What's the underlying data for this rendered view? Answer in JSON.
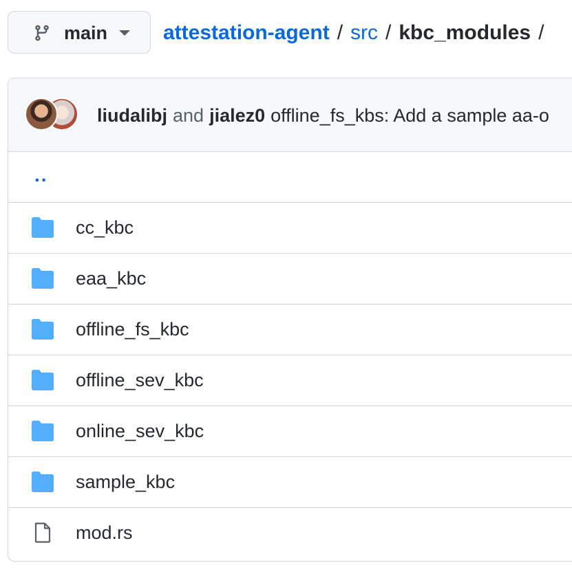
{
  "branch": {
    "name": "main",
    "icon": "git-branch-icon",
    "caret_icon": "triangle-down-icon"
  },
  "breadcrumb": {
    "root": "attestation-agent",
    "parts": [
      "src"
    ],
    "current": "kbc_modules",
    "separator": "/"
  },
  "commit": {
    "author1": "liudalibj",
    "conjunction": "and",
    "author2": "jialez0",
    "message": "offline_fs_kbs: Add a sample aa-o"
  },
  "files": {
    "parent": "..",
    "entries": [
      {
        "name": "cc_kbc",
        "type": "dir",
        "icon": "folder-icon"
      },
      {
        "name": "eaa_kbc",
        "type": "dir",
        "icon": "folder-icon"
      },
      {
        "name": "offline_fs_kbc",
        "type": "dir",
        "icon": "folder-icon"
      },
      {
        "name": "offline_sev_kbc",
        "type": "dir",
        "icon": "folder-icon"
      },
      {
        "name": "online_sev_kbc",
        "type": "dir",
        "icon": "folder-icon"
      },
      {
        "name": "sample_kbc",
        "type": "dir",
        "icon": "folder-icon"
      },
      {
        "name": "mod.rs",
        "type": "file",
        "icon": "file-icon"
      }
    ]
  },
  "colors": {
    "link": "#0969da",
    "folder": "#54aeff",
    "border": "#d0d7de",
    "header_bg": "#f6f8fa"
  }
}
